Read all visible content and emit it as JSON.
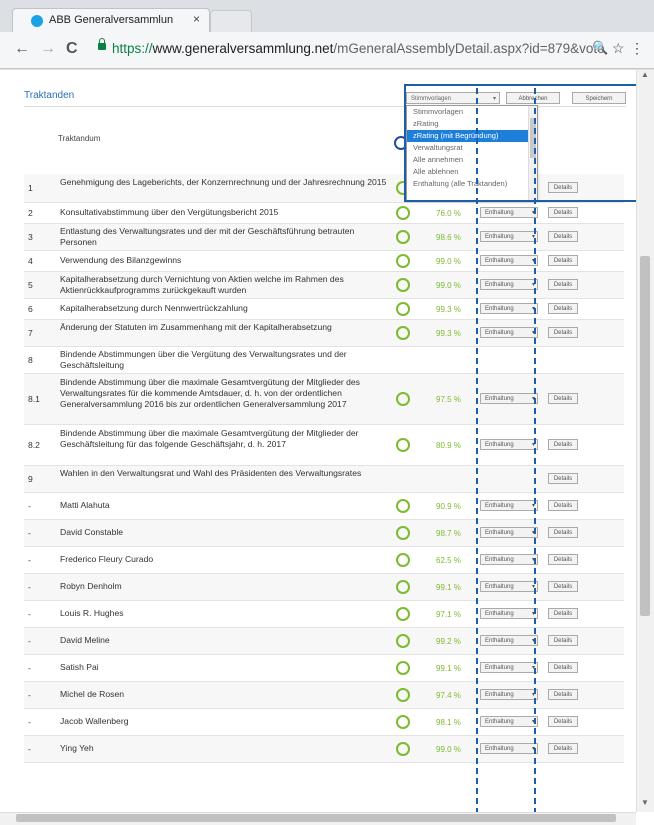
{
  "browser": {
    "tab_title": "ABB Generalversammlun",
    "tab_close": "×",
    "url_scheme": "https://",
    "url_host": "www.generalversammlung.net",
    "url_path": "/mGeneralAssemblyDetail.aspx?id=879&vote",
    "back": "←",
    "forward": "→",
    "reload": "C",
    "zoom": "🔍",
    "star": "☆",
    "menu": "⋮"
  },
  "page": {
    "section_title": "Traktanden",
    "column_header": "Traktandum",
    "vorlagen_label": "Stimmvorlagen",
    "abbrechen_label": "Abbrechen",
    "speichern_label": "Speichern"
  },
  "dropdown": {
    "items": [
      {
        "label": "Stimmvorlagen",
        "selected": false
      },
      {
        "label": "zRating",
        "selected": false
      },
      {
        "label": "zRating (mit Begründung)",
        "selected": true
      },
      {
        "label": "Verwaltungsrat",
        "selected": false
      },
      {
        "label": "Alle annehmen",
        "selected": false
      },
      {
        "label": "Alle ablehnen",
        "selected": false
      },
      {
        "label": "Enthaltung (alle Traktanden)",
        "selected": false
      }
    ]
  },
  "rows": [
    {
      "num": "1",
      "text": "Genehmigung des Lageberichts, der Konzernrechnung und der Jahresrechnung 2015",
      "pct": "",
      "select": "",
      "details": "Details",
      "status": true
    },
    {
      "num": "2",
      "text": "Konsultativabstimmung über den Vergütungsbericht 2015",
      "pct": "76.0 %",
      "select": "Enthaltung",
      "details": "Details",
      "status": true
    },
    {
      "num": "3",
      "text": "Entlastung des Verwaltungsrates und der mit der Geschäftsführung betrauten Personen",
      "pct": "98.6 %",
      "select": "Enthaltung",
      "details": "Details",
      "status": true
    },
    {
      "num": "4",
      "text": "Verwendung des Bilanzgewinns",
      "pct": "99.0 %",
      "select": "Enthaltung",
      "details": "Details",
      "status": true
    },
    {
      "num": "5",
      "text": "Kapitalherabsetzung durch Vernichtung von Aktien welche im Rahmen des Aktienrückkaufprogramms zurückgekauft wurden",
      "pct": "99.0 %",
      "select": "Enthaltung",
      "details": "Details",
      "status": true
    },
    {
      "num": "6",
      "text": "Kapitalherabsetzung durch Nennwertrückzahlung",
      "pct": "99.3 %",
      "select": "Enthaltung",
      "details": "Details",
      "status": true
    },
    {
      "num": "7",
      "text": "Änderung der Statuten im Zusammenhang mit der Kapitalherabsetzung",
      "pct": "99.3 %",
      "select": "Enthaltung",
      "details": "Details",
      "status": true
    },
    {
      "num": "8",
      "text": "Bindende Abstimmungen über die Vergütung des Verwaltungsrates und der Geschäftsleitung",
      "pct": "",
      "select": "",
      "details": "",
      "status": false
    },
    {
      "num": "8.1",
      "text": "Bindende Abstimmung über die maximale Gesamtvergütung der Mitglieder des Verwaltungsrates für die kommende Amtsdauer, d. h. von der ordentlichen Generalversammlung 2016 bis zur ordentlichen Generalversammlung 2017",
      "pct": "97.5 %",
      "select": "Enthaltung",
      "details": "Details",
      "status": true
    },
    {
      "num": "8.2",
      "text": "Bindende Abstimmung über die maximale Gesamtvergütung der Mitglieder der Geschäftsleitung für das folgende Geschäftsjahr, d. h. 2017",
      "pct": "80.9 %",
      "select": "Enthaltung",
      "details": "Details",
      "status": true
    },
    {
      "num": "9",
      "text": "Wahlen in den Verwaltungsrat und Wahl des Präsidenten des Verwaltungsrates",
      "pct": "",
      "select": "",
      "details": "Details",
      "status": false
    },
    {
      "num": "-",
      "text": "Matti Alahuta",
      "pct": "90.9 %",
      "select": "Enthaltung",
      "details": "Details",
      "status": true
    },
    {
      "num": "-",
      "text": "David Constable",
      "pct": "98.7 %",
      "select": "Enthaltung",
      "details": "Details",
      "status": true
    },
    {
      "num": "-",
      "text": "Frederico Fleury Curado",
      "pct": "62.5 %",
      "select": "Enthaltung",
      "details": "Details",
      "status": true
    },
    {
      "num": "-",
      "text": "Robyn Denholm",
      "pct": "99.1 %",
      "select": "Enthaltung",
      "details": "Details",
      "status": true
    },
    {
      "num": "-",
      "text": "Louis R. Hughes",
      "pct": "97.1 %",
      "select": "Enthaltung",
      "details": "Details",
      "status": true
    },
    {
      "num": "-",
      "text": "David Meline",
      "pct": "99.2 %",
      "select": "Enthaltung",
      "details": "Details",
      "status": true
    },
    {
      "num": "-",
      "text": "Satish Pai",
      "pct": "99.1 %",
      "select": "Enthaltung",
      "details": "Details",
      "status": true
    },
    {
      "num": "-",
      "text": "Michel de Rosen",
      "pct": "97.4 %",
      "select": "Enthaltung",
      "details": "Details",
      "status": true
    },
    {
      "num": "-",
      "text": "Jacob Wallenberg",
      "pct": "98.1 %",
      "select": "Enthaltung",
      "details": "Details",
      "status": true
    },
    {
      "num": "-",
      "text": "Ying Yeh",
      "pct": "99.0 %",
      "select": "Enthaltung",
      "details": "Details",
      "status": true
    }
  ],
  "colors": {
    "accent": "#1d5ea8",
    "status": "#7dbb2e",
    "selection": "#1e7fd9"
  }
}
